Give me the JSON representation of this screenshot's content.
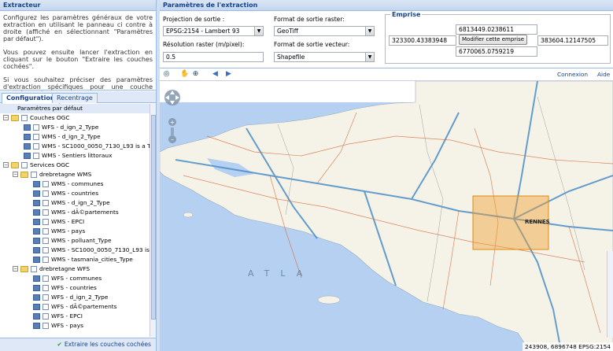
{
  "left_panel": {
    "title": "Extracteur",
    "intro": [
      "Configurez les paramètres généraux de votre extraction en utilisant le panneau ci contre à droite (affiché en sélectionnant \"Paramètres par défaut\").",
      "Vous pouvez ensuite lancer l'extraction en cliquant sur le bouton \"Extraire les couches cochées\".",
      "Si vous souhaitez préciser des paramètres d'extraction spécifiques pour une couche donnée, sélectionnez la dans l'arbre ci-dessous."
    ],
    "tabs": [
      "Configuration",
      "Recentrage"
    ],
    "tree": [
      {
        "label": "Paramètres par défaut",
        "level": 0,
        "kind": "root",
        "selected": true
      },
      {
        "label": "Couches OGC",
        "level": 0,
        "kind": "folder"
      },
      {
        "label": "WFS - d_ign_2_Type",
        "level": 1,
        "kind": "layer"
      },
      {
        "label": "WMS - d_ign_2_Type",
        "level": 1,
        "kind": "layer"
      },
      {
        "label": "WMS - SC1000_0050_7130_L93 is a T...",
        "level": 1,
        "kind": "layer"
      },
      {
        "label": "WMS - Sentiers littoraux",
        "level": 1,
        "kind": "layer"
      },
      {
        "label": "Services OGC",
        "level": 0,
        "kind": "folder"
      },
      {
        "label": "drebretagne WMS",
        "level": 1,
        "kind": "folder"
      },
      {
        "label": "WMS - communes",
        "level": 2,
        "kind": "layer"
      },
      {
        "label": "WMS - countries",
        "level": 2,
        "kind": "layer"
      },
      {
        "label": "WMS - d_ign_2_Type",
        "level": 2,
        "kind": "layer"
      },
      {
        "label": "WMS - dÃ©partements",
        "level": 2,
        "kind": "layer"
      },
      {
        "label": "WMS - EPCI",
        "level": 2,
        "kind": "layer"
      },
      {
        "label": "WMS - pays",
        "level": 2,
        "kind": "layer"
      },
      {
        "label": "WMS - polluant_Type",
        "level": 2,
        "kind": "layer"
      },
      {
        "label": "WMS - SC1000_0050_7130_L93 is a T...",
        "level": 2,
        "kind": "layer"
      },
      {
        "label": "WMS - tasmania_cities_Type",
        "level": 2,
        "kind": "layer"
      },
      {
        "label": "drebretagne WFS",
        "level": 1,
        "kind": "folder"
      },
      {
        "label": "WFS - communes",
        "level": 2,
        "kind": "layer"
      },
      {
        "label": "WFS - countries",
        "level": 2,
        "kind": "layer"
      },
      {
        "label": "WFS - d_ign_2_Type",
        "level": 2,
        "kind": "layer"
      },
      {
        "label": "WFS - dÃ©partements",
        "level": 2,
        "kind": "layer"
      },
      {
        "label": "WFS - EPCI",
        "level": 2,
        "kind": "layer"
      },
      {
        "label": "WFS - pays",
        "level": 2,
        "kind": "layer"
      }
    ],
    "extract_button": "Extraire les couches cochées"
  },
  "params": {
    "title": "Paramètres de l'extraction",
    "projection_label": "Projection de sortie :",
    "projection_value": "EPSG:2154 - Lambert 93",
    "raster_format_label": "Format de sortie raster:",
    "raster_format_value": "GeoTiff",
    "resolution_label": "Résolution raster (m/pixel):",
    "resolution_value": "0.5",
    "vector_format_label": "Format de sortie vecteur:",
    "vector_format_value": "Shapefile",
    "emprise": {
      "title": "Emprise",
      "north": "6813449.0238611",
      "west": "323300.43383948",
      "east": "383604.12147505",
      "south": "6770065.0759219",
      "modify_button": "Modifier cette emprise"
    }
  },
  "toolbar": {
    "connexion": "Connexion",
    "aide": "Aide"
  },
  "map": {
    "city_label": "RENNES",
    "sea_label": "ATLA",
    "coords": "243908, 6896748",
    "crs": "EPSG:2154"
  },
  "colors": {
    "header_text": "#15428b",
    "selection": "#f0a030",
    "sea": "#b5d0f0",
    "land": "#f5f3e8"
  }
}
